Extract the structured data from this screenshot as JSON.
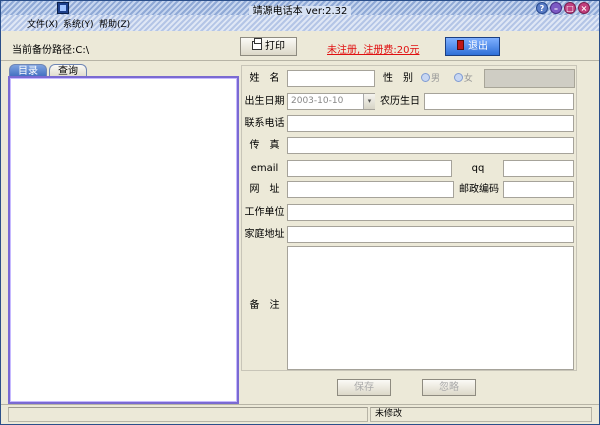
{
  "window": {
    "title": "靖源电话本 ver:2.32"
  },
  "menu": [
    "文件(X)",
    "系统(Y)",
    "帮助(Z)"
  ],
  "toolbar": {
    "backup_path_label": "当前备份路径:C:\\",
    "print_label": "打印",
    "unregistered_text": "未注册, 注册费:20元",
    "exit_label": "退出"
  },
  "tabs": [
    "目录",
    "查询"
  ],
  "form": {
    "name_label": "姓　名",
    "gender_label": "性　别",
    "gender_male": "男",
    "gender_female": "女",
    "birthday_label": "出生日期",
    "birthday_value": "2003-10-10",
    "lunar_birthday_label": "农历生日",
    "phone_label": "联系电话",
    "fax_label": "传　真",
    "email_label": "email",
    "qq_label": "qq",
    "website_label": "网　址",
    "zip_label": "邮政编码",
    "work_label": "工作单位",
    "home_label": "家庭地址",
    "notes_label": "备　注",
    "save_label": "保存",
    "ignore_label": "忽略"
  },
  "status": {
    "modified_text": "未修改"
  },
  "colors": {
    "accent_red": "#e01010",
    "panel_border": "#7a6ad2",
    "exit_button": "#2f6fd7"
  }
}
